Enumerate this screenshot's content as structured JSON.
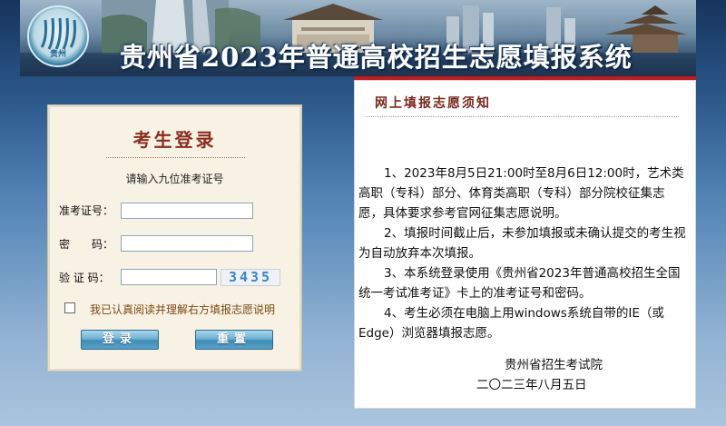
{
  "header": {
    "title": "贵州省2023年普通高校招生志愿填报系统",
    "logo_text": "贵州",
    "logo_icon": "exam-authority-logo"
  },
  "login": {
    "title": "考生登录",
    "hint": "请输入九位准考证号",
    "ticket_label": "准考证号：",
    "password_label": "密　　码：",
    "captcha_label": "验 证 码：",
    "ticket_value": "",
    "password_value": "",
    "captcha_value": "",
    "captcha_image_text": "3435",
    "agree_text": "我已认真阅读并理解右方填报志愿说明",
    "agree_checked": false,
    "login_button": "登录",
    "reset_button": "重置"
  },
  "notice": {
    "title": "网上填报志愿须知",
    "items": [
      "1、2023年8月5日21:00时至8月6日12:00时，艺术类高职（专科）部分、体育类高职（专科）部分院校征集志愿，具体要求参考官网征集志愿说明。",
      "2、填报时间截止后，未参加填报或未确认提交的考生视为自动放弃本次填报。",
      "3、本系统登录使用《贵州省2023年普通高校招生全国统一考试准考证》卡上的准考证号和密码。",
      "4、考生必须在电脑上用windows系统自带的IE（或Edge）浏览器填报志愿。"
    ],
    "signature_org": "贵州省招生考试院",
    "signature_date": "二〇二三年八月五日"
  },
  "colors": {
    "accent_red": "#c8181a",
    "title_brown": "#8b2d1e",
    "button_blue": "#3e8cb5"
  }
}
